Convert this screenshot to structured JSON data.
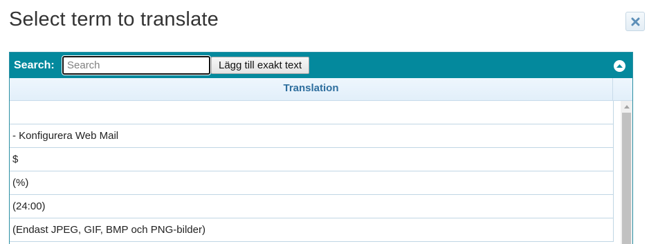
{
  "dialog": {
    "title": "Select term to translate",
    "close_icon": "close-x-icon"
  },
  "toolbar": {
    "search_label": "Search:",
    "search_placeholder": "Search",
    "search_value": "",
    "exact_button_label": "Lägg till exakt text",
    "collapse_icon": "collapse-up-icon"
  },
  "table": {
    "column_header": "Translation",
    "rows": [
      "",
      " - Konfigurera Web Mail",
      "$",
      "(%)",
      "(24:00)",
      "(Endast JPEG, GIF, BMP och PNG-bilder)"
    ]
  },
  "colors": {
    "toolbar_bg": "#04899d",
    "header_text": "#2e6e9e",
    "row_border": "#c0d6e4"
  }
}
